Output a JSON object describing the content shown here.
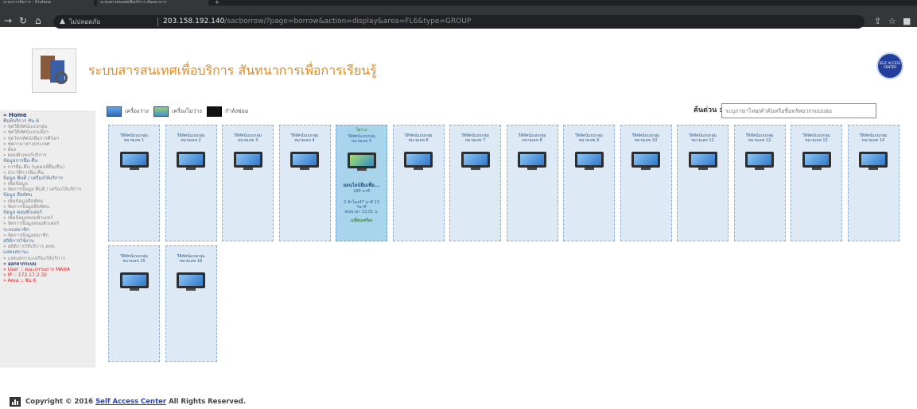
{
  "browser": {
    "tabs": [
      {
        "title": "ระบบการจัดการ - Grafana"
      },
      {
        "title": "ระบบสารสนเทศเพื่อบริการ สันทนาการ"
      }
    ],
    "address": {
      "security_label": "ไม่ปลอดภัย",
      "host": "203.158.192.140",
      "path": "/sacborrow/?page=borrow&action=display&area=FL6&type=GROUP"
    }
  },
  "header": {
    "title": "ระบบสารสนเทศเพื่อบริการ สันทนาการเพื่อการเรียนรู้",
    "badge_text": "SELF ACCESS CENTER"
  },
  "sidebar": {
    "items": [
      {
        "label": "» Home",
        "kind": "home"
      },
      {
        "label": "พื้นที่บริการ ชั้น 6",
        "kind": "head"
      },
      {
        "label": "» ชุดวีดิทัศน์แบบกลุ่ม",
        "kind": "item"
      },
      {
        "label": "» ชุดวีดิทัศน์แบบเดี่ยว",
        "kind": "item"
      },
      {
        "label": "» ชุดโทรทัศน์เพื่อการศึกษา",
        "kind": "item"
      },
      {
        "label": "» ชุดภาษาต่างประเทศ",
        "kind": "item"
      },
      {
        "label": "» ห้อง",
        "kind": "item"
      },
      {
        "label": "» คอมพิวเตอร์บริการ",
        "kind": "item"
      },
      {
        "label": "ข้อมูลการยืม-คืน",
        "kind": "head"
      },
      {
        "label": "» การยืม-คืน (บุคคลที่ยืม/คืน)",
        "kind": "item"
      },
      {
        "label": "» ประวัติการยืม-คืน",
        "kind": "item"
      },
      {
        "label": "ข้อมูล พื้นที่ / เครื่องให้บริการ",
        "kind": "head"
      },
      {
        "label": "» เพิ่มข้อมูล",
        "kind": "item"
      },
      {
        "label": "» จัดการข้อมูล พื้นที่ / เครื่องให้บริการ",
        "kind": "item"
      },
      {
        "label": "ข้อมูล สื่อทัศน",
        "kind": "head"
      },
      {
        "label": "» เพิ่มข้อมูลสื่อทัศน",
        "kind": "item"
      },
      {
        "label": "» จัดการข้อมูลสื่อทัศน",
        "kind": "item"
      },
      {
        "label": "ข้อมูล คอมพิวเตอร์",
        "kind": "head"
      },
      {
        "label": "» เพิ่มข้อมูลคอมพิวเตอร์",
        "kind": "item"
      },
      {
        "label": "» จัดการข้อมูลคอมพิวเตอร์",
        "kind": "item"
      },
      {
        "label": "ระบบสมาชิก",
        "kind": "head"
      },
      {
        "label": "» จัดการข้อมูลสมาชิก",
        "kind": "item"
      },
      {
        "label": "สถิติการใช้งาน",
        "kind": "head"
      },
      {
        "label": "» สถิติการใช้บริการ สทล.",
        "kind": "item"
      },
      {
        "label": "แสดงสถานะ",
        "kind": "head"
      },
      {
        "label": "» แสดงสถานะเครื่องให้บริการ",
        "kind": "item"
      },
      {
        "label": "» ออกจากระบบ",
        "kind": "exit"
      },
      {
        "label": "» User :: คณะกรรมการ MAHA",
        "kind": "red"
      },
      {
        "label": "» IP :: 172.17.2.32",
        "kind": "red"
      },
      {
        "label": "» Area :: ชั้น 6",
        "kind": "red"
      }
    ]
  },
  "legend": {
    "available": "เครื่องว่าง",
    "busy": "เครื่องไม่ว่าง",
    "maintenance": "กำลังซ่อม"
  },
  "search": {
    "label": "ค้นด่วน :",
    "placeholder": "ระบุภาษาไทย/คำค้นหรือชื่อทรัพยากรแบบย่อ"
  },
  "rooms": [
    {
      "name": "วีดิทัศน์แบบกลุ่ม",
      "number": "หมายเลข 1",
      "status": "available"
    },
    {
      "name": "วีดิทัศน์แบบกลุ่ม",
      "number": "หมายเลข 2",
      "status": "available"
    },
    {
      "name": "วีดิทัศน์แบบกลุ่ม",
      "number": "หมายเลข 3",
      "status": "available"
    },
    {
      "name": "วีดิทัศน์แบบกลุ่ม",
      "number": "หมายเลข 4",
      "status": "available"
    },
    {
      "name": "วีดิทัศน์แบบกลุ่ม",
      "number": "หมายเลข 5",
      "status": "busy",
      "status_text": "ไม่ว่าง",
      "user": "ออนไลน์ยืมเพื่อ...",
      "minutes": "180 นาที",
      "used": "2 ชั่วโมง47 นาที 13 วินาที",
      "end": "หมดเวลา 12:01 น.",
      "action": "เปลี่ยนเครื่อง"
    },
    {
      "name": "วีดิทัศน์แบบกลุ่ม",
      "number": "หมายเลข 6",
      "status": "available"
    },
    {
      "name": "วีดิทัศน์แบบกลุ่ม",
      "number": "หมายเลข 7",
      "status": "available"
    },
    {
      "name": "วีดิทัศน์แบบกลุ่ม",
      "number": "หมายเลข 8",
      "status": "available"
    },
    {
      "name": "วีดิทัศน์แบบกลุ่ม",
      "number": "หมายเลข 9",
      "status": "available"
    },
    {
      "name": "วีดิทัศน์แบบกลุ่ม",
      "number": "หมายเลข 10",
      "status": "available"
    },
    {
      "name": "วีดิทัศน์แบบกลุ่ม",
      "number": "หมายเลข 11",
      "status": "available"
    },
    {
      "name": "วีดิทัศน์แบบกลุ่ม",
      "number": "หมายเลข 12",
      "status": "available"
    },
    {
      "name": "วีดิทัศน์แบบกลุ่ม",
      "number": "หมายเลข 13",
      "status": "available"
    },
    {
      "name": "วีดิทัศน์แบบกลุ่ม",
      "number": "หมายเลข 14",
      "status": "available"
    },
    {
      "name": "วีดิทัศน์แบบกลุ่ม",
      "number": "หมายเลข 15",
      "status": "available"
    },
    {
      "name": "วีดิทัศน์แบบกลุ่ม",
      "number": "หมายเลข 16",
      "status": "available"
    }
  ],
  "footer": {
    "prefix": "Copyright © 2016",
    "link": "Self Access Center",
    "suffix": "All Rights Reserved."
  },
  "colors": {
    "title_orange": "#e58a1f",
    "card_bg": "#ddeaf6",
    "card_busy_bg": "#a8d5ec",
    "sidebar_bg": "#ededed"
  }
}
